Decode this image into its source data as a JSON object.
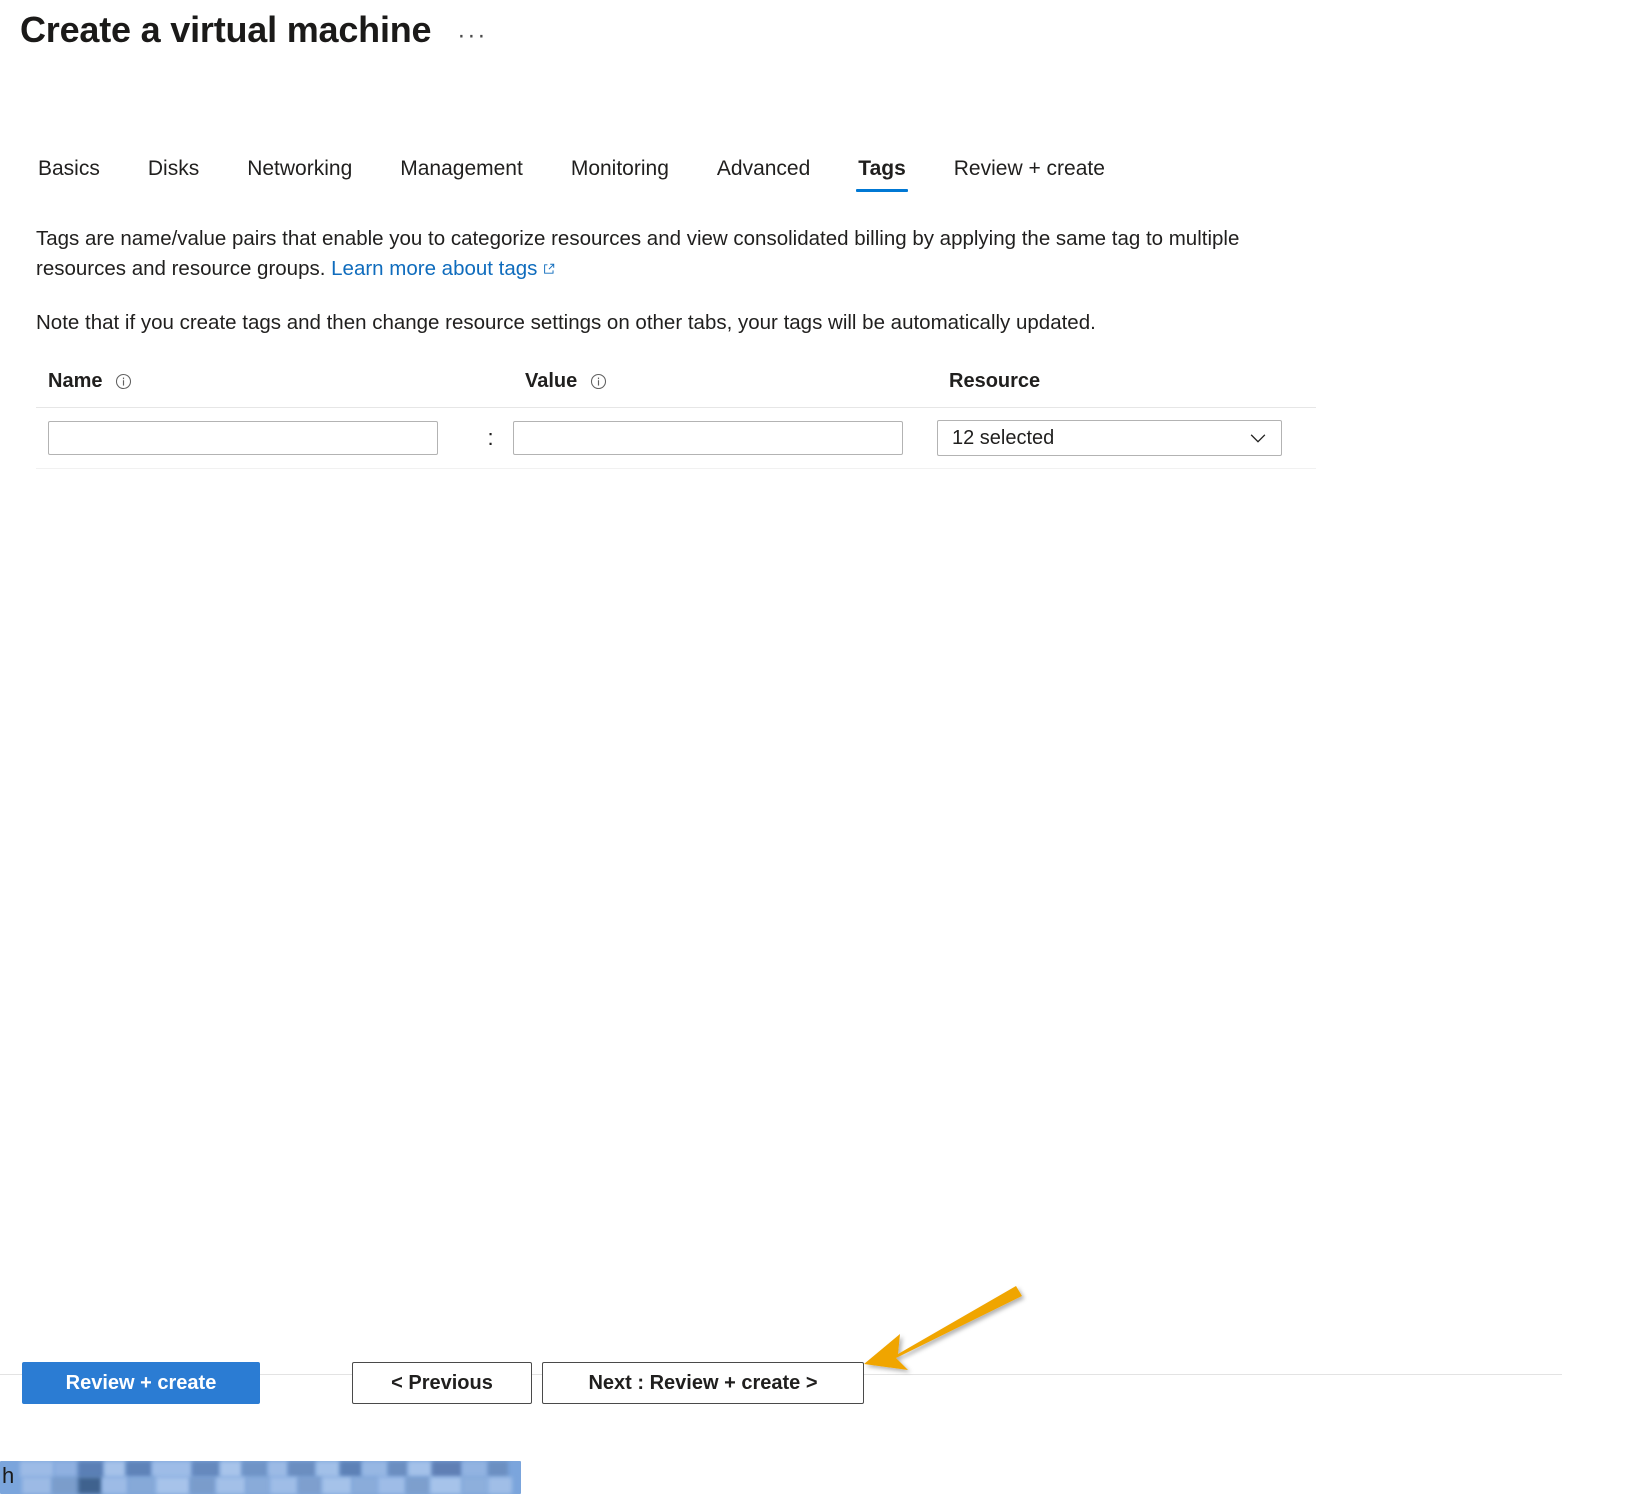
{
  "page": {
    "title": "Create a virtual machine",
    "ellipsis": "···"
  },
  "tabs": [
    {
      "label": "Basics",
      "selected": false
    },
    {
      "label": "Disks",
      "selected": false
    },
    {
      "label": "Networking",
      "selected": false
    },
    {
      "label": "Management",
      "selected": false
    },
    {
      "label": "Monitoring",
      "selected": false
    },
    {
      "label": "Advanced",
      "selected": false
    },
    {
      "label": "Tags",
      "selected": true
    },
    {
      "label": "Review + create",
      "selected": false
    }
  ],
  "intro": {
    "text_before_link": "Tags are name/value pairs that enable you to categorize resources and view consolidated billing by applying the same tag to multiple resources and resource groups. ",
    "link_label": "Learn more about tags",
    "link_icon": "external-link-icon"
  },
  "note": {
    "text": "Note that if you create tags and then change resource settings on other tabs, your tags will be automatically updated."
  },
  "tag_grid": {
    "columns": [
      {
        "header": "Name",
        "info_icon": "info-icon"
      },
      {
        "header": "Value",
        "info_icon": "info-icon"
      },
      {
        "header": "Resource",
        "info_icon": null
      }
    ],
    "separator": ":",
    "rows": [
      {
        "name_value": "",
        "name_placeholder": "",
        "value_value": "",
        "value_placeholder": "",
        "resource_selected": "12 selected",
        "resource_chevron": "chevron-down-icon"
      }
    ]
  },
  "footer": {
    "review_create_label": "Review + create",
    "previous_label": "< Previous",
    "next_label": "Next : Review + create >"
  },
  "annotation": {
    "type": "arrow",
    "color": "#F0A500",
    "points_to": "next-review-create-button"
  },
  "colors": {
    "accent": "#0078d4",
    "primary_button": "#2b7cd3",
    "link": "#0f6cbd",
    "annotation_arrow": "#F0A500",
    "text": "#201f1e",
    "border": "#b3b3b3",
    "taskbar_highlight": "#7ba5dc"
  },
  "taskbar": {
    "visible_glyph": "h"
  }
}
